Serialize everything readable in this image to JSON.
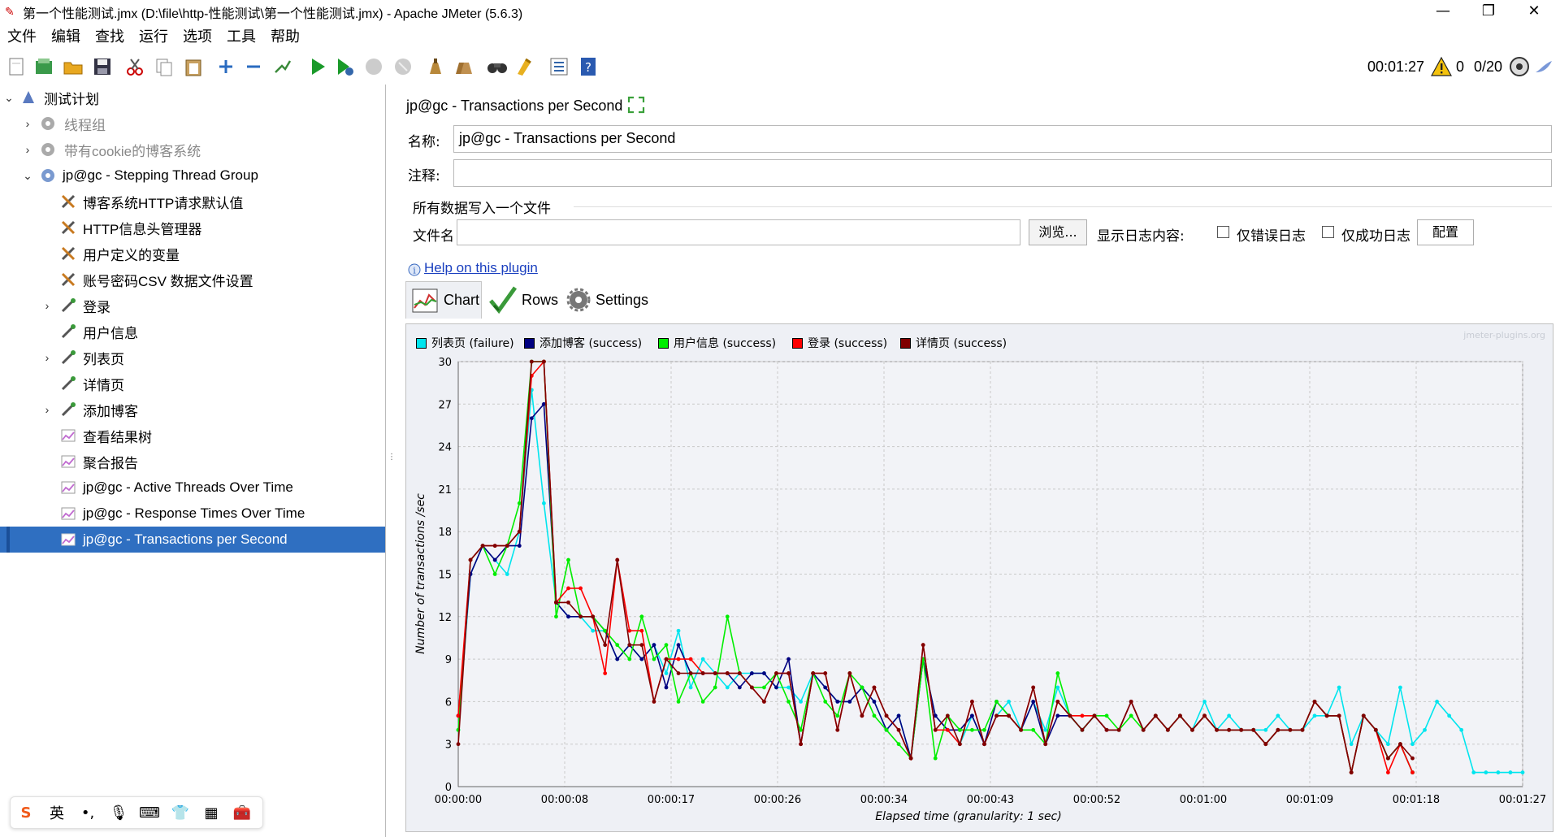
{
  "window": {
    "title": "第一个性能测试.jmx (D:\\file\\http-性能测试\\第一个性能测试.jmx) - Apache JMeter (5.6.3)",
    "controls": [
      "—",
      "❐",
      "✕"
    ]
  },
  "menu": [
    "文件",
    "编辑",
    "查找",
    "运行",
    "选项",
    "工具",
    "帮助"
  ],
  "toolbar": {
    "elapsed": "00:01:27",
    "errors": "0",
    "threads": "0/20",
    "icons": [
      "new-icon",
      "templates-icon",
      "open-icon",
      "save-icon",
      "cut-icon",
      "copy-icon",
      "paste-icon",
      "expand-icon",
      "collapse-icon",
      "toggle-icon",
      "start-icon",
      "start-no-pause-icon",
      "stop-icon",
      "shutdown-icon",
      "clear-icon",
      "clear-all-icon",
      "search-icon",
      "reset-search-icon",
      "function-helper-icon",
      "help-icon"
    ]
  },
  "tree": [
    {
      "label": "测试计划",
      "level": 0,
      "expander": "down",
      "icon": "test-plan-icon"
    },
    {
      "label": "线程组",
      "level": 1,
      "expander": "right",
      "icon": "thread-group-disabled-icon",
      "muted": true
    },
    {
      "label": "带有cookie的博客系统",
      "level": 1,
      "expander": "right",
      "icon": "thread-group-disabled-icon",
      "muted": true
    },
    {
      "label": "jp@gc - Stepping Thread Group",
      "level": 1,
      "expander": "down",
      "icon": "thread-group-icon"
    },
    {
      "label": "博客系统HTTP请求默认值",
      "level": 2,
      "expander": "",
      "icon": "config-icon"
    },
    {
      "label": "HTTP信息头管理器",
      "level": 2,
      "expander": "",
      "icon": "config-icon"
    },
    {
      "label": "用户定义的变量",
      "level": 2,
      "expander": "",
      "icon": "config-icon"
    },
    {
      "label": "账号密码CSV 数据文件设置",
      "level": 2,
      "expander": "",
      "icon": "config-icon"
    },
    {
      "label": "登录",
      "level": 2,
      "expander": "right",
      "icon": "sampler-icon"
    },
    {
      "label": "用户信息",
      "level": 2,
      "expander": "",
      "icon": "sampler-icon"
    },
    {
      "label": "列表页",
      "level": 2,
      "expander": "right",
      "icon": "sampler-icon"
    },
    {
      "label": "详情页",
      "level": 2,
      "expander": "",
      "icon": "sampler-icon"
    },
    {
      "label": "添加博客",
      "level": 2,
      "expander": "right",
      "icon": "sampler-icon"
    },
    {
      "label": "查看结果树",
      "level": 2,
      "expander": "",
      "icon": "listener-icon"
    },
    {
      "label": "聚合报告",
      "level": 2,
      "expander": "",
      "icon": "listener-icon"
    },
    {
      "label": "jp@gc - Active Threads Over Time",
      "level": 2,
      "expander": "",
      "icon": "listener-icon"
    },
    {
      "label": "jp@gc - Response Times Over Time",
      "level": 2,
      "expander": "",
      "icon": "listener-icon"
    },
    {
      "label": "jp@gc - Transactions per Second",
      "level": 2,
      "expander": "",
      "icon": "listener-icon",
      "selected": true
    }
  ],
  "panel": {
    "title": "jp@gc - Transactions per Second",
    "name_label": "名称:",
    "name_value": "jp@gc - Transactions per Second",
    "comment_label": "注释:",
    "comment_value": "",
    "section_title": "所有数据写入一个文件",
    "filename_label": "文件名",
    "filename_value": "",
    "browse": "浏览...",
    "log_display": "显示日志内容:",
    "errors_only": "仅错误日志",
    "success_only": "仅成功日志",
    "configure": "配置",
    "help_link": "Help on this plugin",
    "tabs": [
      "Chart",
      "Rows",
      "Settings"
    ],
    "watermark": "jmeter-plugins.org"
  },
  "colors": {
    "selection": "#2f6fc1",
    "chart_bg": "#eef0f5",
    "grid": "#c9c9c9"
  },
  "ime": [
    "S",
    "英",
    "•,",
    "🎙",
    "⌨",
    "👕",
    "▦",
    "🧰"
  ],
  "chart_data": {
    "type": "line",
    "title": "",
    "xlabel": "Elapsed time (granularity: 1 sec)",
    "ylabel": "Number of transactions /sec",
    "ylim": [
      0,
      30
    ],
    "yticks": [
      0,
      3,
      6,
      9,
      12,
      15,
      18,
      21,
      24,
      27,
      30
    ],
    "xlim": [
      0,
      87
    ],
    "xticks": [
      "00:00:00",
      "00:00:08",
      "00:00:17",
      "00:00:26",
      "00:00:34",
      "00:00:43",
      "00:00:52",
      "00:01:00",
      "00:01:09",
      "00:01:18",
      "00:01:27"
    ],
    "grid": true,
    "legend_position": "top-left",
    "series": [
      {
        "name": "列表页 (failure)",
        "color": "#00e5ee",
        "x": [
          0,
          1,
          2,
          3,
          4,
          5,
          6,
          7,
          8,
          9,
          10,
          11,
          12,
          13,
          14,
          15,
          16,
          17,
          18,
          19,
          20,
          21,
          22,
          23,
          24,
          25,
          26,
          27,
          28,
          29,
          30,
          31,
          32,
          33,
          34,
          35,
          36,
          37,
          38,
          39,
          40,
          41,
          42,
          43,
          44,
          45,
          46,
          47,
          48,
          49,
          50,
          51,
          52,
          53,
          54,
          55,
          56,
          57,
          58,
          59,
          60,
          61,
          62,
          63,
          64,
          65,
          66,
          67,
          68,
          69,
          70,
          71,
          72,
          73,
          74,
          75,
          76,
          77,
          78,
          79,
          80,
          81,
          82,
          83,
          84,
          85,
          86,
          87
        ],
        "values": [
          4,
          15,
          17,
          16,
          15,
          18,
          28,
          20,
          13,
          12,
          12,
          11,
          11,
          9,
          10,
          9,
          10,
          8,
          11,
          7,
          9,
          8,
          7,
          8,
          8,
          8,
          7,
          7,
          6,
          8,
          7,
          6,
          6,
          7,
          6,
          4,
          5,
          2,
          9,
          5,
          4,
          3,
          5,
          3,
          5,
          6,
          4,
          6,
          4,
          7,
          5,
          4,
          5,
          4,
          4,
          6,
          4,
          5,
          4,
          5,
          4,
          6,
          4,
          5,
          4,
          4,
          4,
          5,
          4,
          4,
          5,
          5,
          7,
          3,
          5,
          4,
          3,
          7,
          3,
          4,
          6,
          5,
          4,
          1,
          1,
          1,
          1,
          1
        ]
      },
      {
        "name": "添加博客 (success)",
        "color": "#000080",
        "x": [
          0,
          1,
          2,
          3,
          4,
          5,
          6,
          7,
          8,
          9,
          10,
          11,
          12,
          13,
          14,
          15,
          16,
          17,
          18,
          19,
          20,
          21,
          22,
          23,
          24,
          25,
          26,
          27,
          28,
          29,
          30,
          31,
          32,
          33,
          34,
          35,
          36,
          37,
          38,
          39,
          40,
          41,
          42,
          43,
          44,
          45,
          46,
          47,
          48,
          49,
          50,
          51,
          52,
          53,
          54,
          55,
          56,
          57,
          58,
          59,
          60,
          61,
          62,
          63,
          64,
          65,
          66,
          67,
          68,
          69,
          70,
          71,
          72,
          73,
          74,
          75,
          76,
          77,
          78
        ],
        "values": [
          5,
          15,
          17,
          16,
          17,
          17,
          26,
          27,
          13,
          12,
          12,
          12,
          11,
          9,
          10,
          9,
          10,
          7,
          10,
          8,
          8,
          8,
          8,
          7,
          8,
          8,
          7,
          9,
          3,
          8,
          7,
          6,
          6,
          7,
          6,
          4,
          5,
          2,
          9,
          5,
          4,
          4,
          5,
          3,
          6,
          5,
          4,
          6,
          3,
          5,
          5,
          4,
          5,
          4,
          4,
          6,
          4,
          5,
          4,
          5,
          4,
          5,
          4,
          4,
          4,
          4,
          3,
          4,
          4,
          4,
          6,
          5,
          5,
          1,
          5,
          4,
          2,
          3,
          1
        ]
      },
      {
        "name": "用户信息 (success)",
        "color": "#00ee00",
        "x": [
          0,
          1,
          2,
          3,
          4,
          5,
          6,
          7,
          8,
          9,
          10,
          11,
          12,
          13,
          14,
          15,
          16,
          17,
          18,
          19,
          20,
          21,
          22,
          23,
          24,
          25,
          26,
          27,
          28,
          29,
          30,
          31,
          32,
          33,
          34,
          35,
          36,
          37,
          38,
          39,
          40,
          41,
          42,
          43,
          44,
          45,
          46,
          47,
          48,
          49,
          50,
          51,
          52,
          53,
          54,
          55,
          56,
          57,
          58,
          59,
          60,
          61,
          62,
          63,
          64,
          65,
          66,
          67,
          68,
          69,
          70,
          71,
          72,
          73,
          74,
          75,
          76,
          77,
          78
        ],
        "values": [
          4,
          16,
          17,
          15,
          17,
          20,
          30,
          30,
          12,
          16,
          12,
          12,
          11,
          10,
          9,
          12,
          9,
          10,
          6,
          8,
          6,
          7,
          12,
          8,
          7,
          7,
          8,
          6,
          4,
          8,
          6,
          5,
          8,
          7,
          5,
          4,
          3,
          2,
          9,
          2,
          5,
          4,
          4,
          4,
          6,
          5,
          4,
          4,
          3,
          8,
          5,
          4,
          5,
          5,
          4,
          5,
          4,
          5,
          4,
          5,
          4,
          5,
          4,
          4,
          4,
          4,
          3,
          4,
          4,
          4,
          6,
          5,
          5,
          1,
          5,
          4,
          2,
          3,
          1
        ]
      },
      {
        "name": "登录 (success)",
        "color": "#ff0000",
        "x": [
          0,
          1,
          2,
          3,
          4,
          5,
          6,
          7,
          8,
          9,
          10,
          11,
          12,
          13,
          14,
          15,
          16,
          17,
          18,
          19,
          20,
          21,
          22,
          23,
          24,
          25,
          26,
          27,
          28,
          29,
          30,
          31,
          32,
          33,
          34,
          35,
          36,
          37,
          38,
          39,
          40,
          41,
          42,
          43,
          44,
          45,
          46,
          47,
          48,
          49,
          50,
          51,
          52,
          53,
          54,
          55,
          56,
          57,
          58,
          59,
          60,
          61,
          62,
          63,
          64,
          65,
          66,
          67,
          68,
          69,
          70,
          71,
          72,
          73,
          74,
          75,
          76,
          77,
          78
        ],
        "values": [
          5,
          16,
          17,
          17,
          17,
          18,
          29,
          30,
          13,
          14,
          14,
          12,
          8,
          16,
          11,
          11,
          6,
          9,
          9,
          9,
          8,
          8,
          8,
          8,
          7,
          6,
          8,
          8,
          3,
          8,
          8,
          4,
          8,
          5,
          7,
          5,
          4,
          2,
          10,
          4,
          4,
          3,
          6,
          3,
          5,
          5,
          4,
          7,
          3,
          6,
          5,
          5,
          5,
          4,
          4,
          6,
          4,
          5,
          4,
          5,
          4,
          5,
          4,
          4,
          4,
          4,
          3,
          4,
          4,
          4,
          6,
          5,
          5,
          1,
          5,
          4,
          1,
          3,
          1
        ]
      },
      {
        "name": "详情页 (success)",
        "color": "#800000",
        "x": [
          0,
          1,
          2,
          3,
          4,
          5,
          6,
          7,
          8,
          9,
          10,
          11,
          12,
          13,
          14,
          15,
          16,
          17,
          18,
          19,
          20,
          21,
          22,
          23,
          24,
          25,
          26,
          27,
          28,
          29,
          30,
          31,
          32,
          33,
          34,
          35,
          36,
          37,
          38,
          39,
          40,
          41,
          42,
          43,
          44,
          45,
          46,
          47,
          48,
          49,
          50,
          51,
          52,
          53,
          54,
          55,
          56,
          57,
          58,
          59,
          60,
          61,
          62,
          63,
          64,
          65,
          66,
          67,
          68,
          69,
          70,
          71,
          72,
          73,
          74,
          75,
          76,
          77,
          78
        ],
        "values": [
          3,
          16,
          17,
          17,
          17,
          18,
          30,
          30,
          13,
          13,
          12,
          12,
          10,
          16,
          10,
          10,
          6,
          9,
          8,
          8,
          8,
          8,
          8,
          8,
          7,
          6,
          8,
          8,
          3,
          8,
          8,
          4,
          8,
          5,
          7,
          5,
          4,
          2,
          10,
          4,
          5,
          3,
          6,
          3,
          5,
          5,
          4,
          7,
          3,
          6,
          5,
          4,
          5,
          4,
          4,
          6,
          4,
          5,
          4,
          5,
          4,
          5,
          4,
          4,
          4,
          4,
          3,
          4,
          4,
          4,
          6,
          5,
          5,
          1,
          5,
          4,
          2,
          3,
          2
        ]
      }
    ]
  }
}
